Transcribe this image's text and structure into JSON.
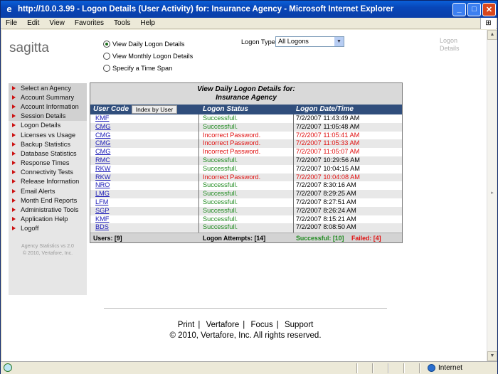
{
  "window": {
    "title": "http://10.0.3.99 - Logon Details (User Activity) for: Insurance Agency - Microsoft Internet Explorer",
    "menu": [
      "File",
      "Edit",
      "View",
      "Favorites",
      "Tools",
      "Help"
    ]
  },
  "header": {
    "logo": "sagitta",
    "radios": [
      {
        "label": "View Daily Logon Details",
        "selected": true
      },
      {
        "label": "View Monthly Logon Details",
        "selected": false
      },
      {
        "label": "Specify a Time Span",
        "selected": false
      }
    ],
    "logon_type_label": "Logon Type:",
    "logon_type_value": "All Logons",
    "page_label": "Logon Details"
  },
  "sidebar": {
    "items": [
      "Select an Agency",
      "Account Summary",
      "Account Information",
      "Session Details",
      "Logon Details",
      "Licenses vs Usage",
      "Backup Statistics",
      "Database Statistics",
      "Response Times",
      "Connectivity Tests",
      "Release Information",
      "Email Alerts",
      "Month End Reports",
      "Administrative Tools",
      "Application Help",
      "Logoff"
    ],
    "footer_line1": "Agency Statistics vs 2.0",
    "footer_line2": "© 2010,  Vertafore, Inc."
  },
  "panel": {
    "heading_line1": "View Daily Logon Details for:",
    "heading_line2": "Insurance Agency",
    "col_user": "User Code",
    "index_button": "Index by User",
    "col_status": "Logon Status",
    "col_datetime": "Logon Date/Time",
    "rows": [
      {
        "user": "KMF",
        "status": "Successfull.",
        "time": "7/2/2007 11:43:49 AM",
        "failed": false
      },
      {
        "user": "CMG",
        "status": "Successfull.",
        "time": "7/2/2007 11:05:48 AM",
        "failed": false
      },
      {
        "user": "CMG",
        "status": "Incorrect Password.",
        "time": "7/2/2007 11:05:41 AM",
        "failed": true
      },
      {
        "user": "CMG",
        "status": "Incorrect Password.",
        "time": "7/2/2007 11:05:33 AM",
        "failed": true
      },
      {
        "user": "CMG",
        "status": "Incorrect Password.",
        "time": "7/2/2007 11:05:07 AM",
        "failed": true
      },
      {
        "user": "RMC",
        "status": "Successfull.",
        "time": "7/2/2007 10:29:56 AM",
        "failed": false
      },
      {
        "user": "RKW",
        "status": "Successfull.",
        "time": "7/2/2007 10:04:15 AM",
        "failed": false
      },
      {
        "user": "RKW",
        "status": "Incorrect Password.",
        "time": "7/2/2007 10:04:08 AM",
        "failed": true
      },
      {
        "user": "NRO",
        "status": "Successfull.",
        "time": "7/2/2007 8:30:16 AM",
        "failed": false
      },
      {
        "user": "LMG",
        "status": "Successfull.",
        "time": "7/2/2007 8:29:25 AM",
        "failed": false
      },
      {
        "user": "LFM",
        "status": "Successfull.",
        "time": "7/2/2007 8:27:51 AM",
        "failed": false
      },
      {
        "user": "SGP",
        "status": "Successfull.",
        "time": "7/2/2007 8:26:24 AM",
        "failed": false
      },
      {
        "user": "KMF",
        "status": "Successfull.",
        "time": "7/2/2007 8:15:21 AM",
        "failed": false
      },
      {
        "user": "BDS",
        "status": "Successfull.",
        "time": "7/2/2007 8:08:50 AM",
        "failed": false
      }
    ],
    "footer_users": "Users: [9]",
    "footer_attempts": "Logon Attempts: [14]",
    "footer_success": "Successful: [10]",
    "footer_failed": "Failed: [4]"
  },
  "footer": {
    "links": [
      "Print",
      "Vertafore",
      "Focus",
      "Support"
    ],
    "copyright": "© 2010,  Vertafore, Inc. All rights reserved."
  },
  "statusbar": {
    "zone": "Internet"
  },
  "colors": {
    "success": "#1e8a1e",
    "failed": "#e01010",
    "table_header": "#304e7c",
    "link": "#1c1cb8"
  }
}
